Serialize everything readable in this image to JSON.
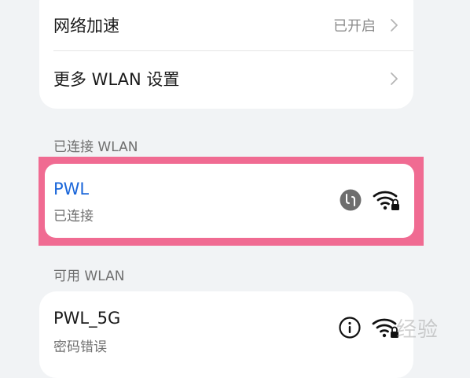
{
  "settings": {
    "network_accel_label": "网络加速",
    "network_accel_value": "已开启",
    "more_wlan_label": "更多 WLAN 设置"
  },
  "connected": {
    "section_title": "已连接 WLAN",
    "network": {
      "name": "PWL",
      "status": "已连接",
      "icon": "huawei-share-icon",
      "signal": "wifi-locked-icon"
    }
  },
  "available": {
    "section_title": "可用 WLAN",
    "networks": [
      {
        "name": "PWL_5G",
        "status": "密码错误",
        "icon": "info-icon",
        "signal": "wifi-locked-icon"
      }
    ]
  },
  "watermark": "经验",
  "colors": {
    "accent": "#1a66d9",
    "highlight": "#f06b92"
  }
}
